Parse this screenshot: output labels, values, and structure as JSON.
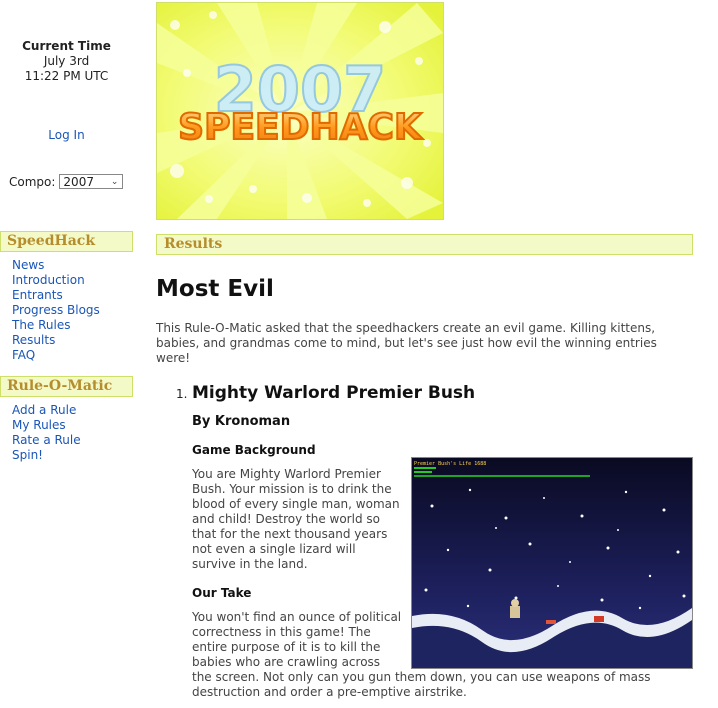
{
  "sidebar": {
    "clock": {
      "label": "Current Time",
      "date": "July 3rd",
      "time": "11:22 PM UTC"
    },
    "login": "Log In",
    "compo": {
      "label": "Compo:",
      "selected": "2007"
    },
    "speedhack": {
      "heading": "SpeedHack",
      "items": [
        "News",
        "Introduction",
        "Entrants",
        "Progress Blogs",
        "The Rules",
        "Results",
        "FAQ"
      ]
    },
    "ruleomatic": {
      "heading": "Rule-O-Matic",
      "items": [
        "Add a Rule",
        "My Rules",
        "Rate a Rule",
        "Spin!"
      ]
    }
  },
  "banner": {
    "year": "2007",
    "logo": "SPEEDHACK"
  },
  "main": {
    "section_heading": "Results",
    "title": "Most Evil",
    "intro": "This Rule-O-Matic asked that the speedhackers create an evil game. Killing kittens, babies, and grandmas come to mind, but let's see just how evil the winning entries were!",
    "entries": [
      {
        "number": "1.",
        "title": "Mighty Warlord Premier Bush",
        "author": "By Kronoman",
        "background_heading": "Game Background",
        "background_text": "You are Mighty Warlord Premier Bush. Your mission is to drink the blood of every single man, woman and child! Destroy the world so that for the next thousand years not even a single lizard will survive in the land.",
        "take_heading": "Our Take",
        "take_text": "You won't find an ounce of political correctness in this game! The entire purpose of it is to kill the babies who are crawling across the screen. Not only can you gun them down, you can use weapons of mass destruction and order a pre-emptive airstrike.",
        "screenshot": {
          "hud_title": "Premier Bush's Life 1688"
        }
      }
    ]
  }
}
